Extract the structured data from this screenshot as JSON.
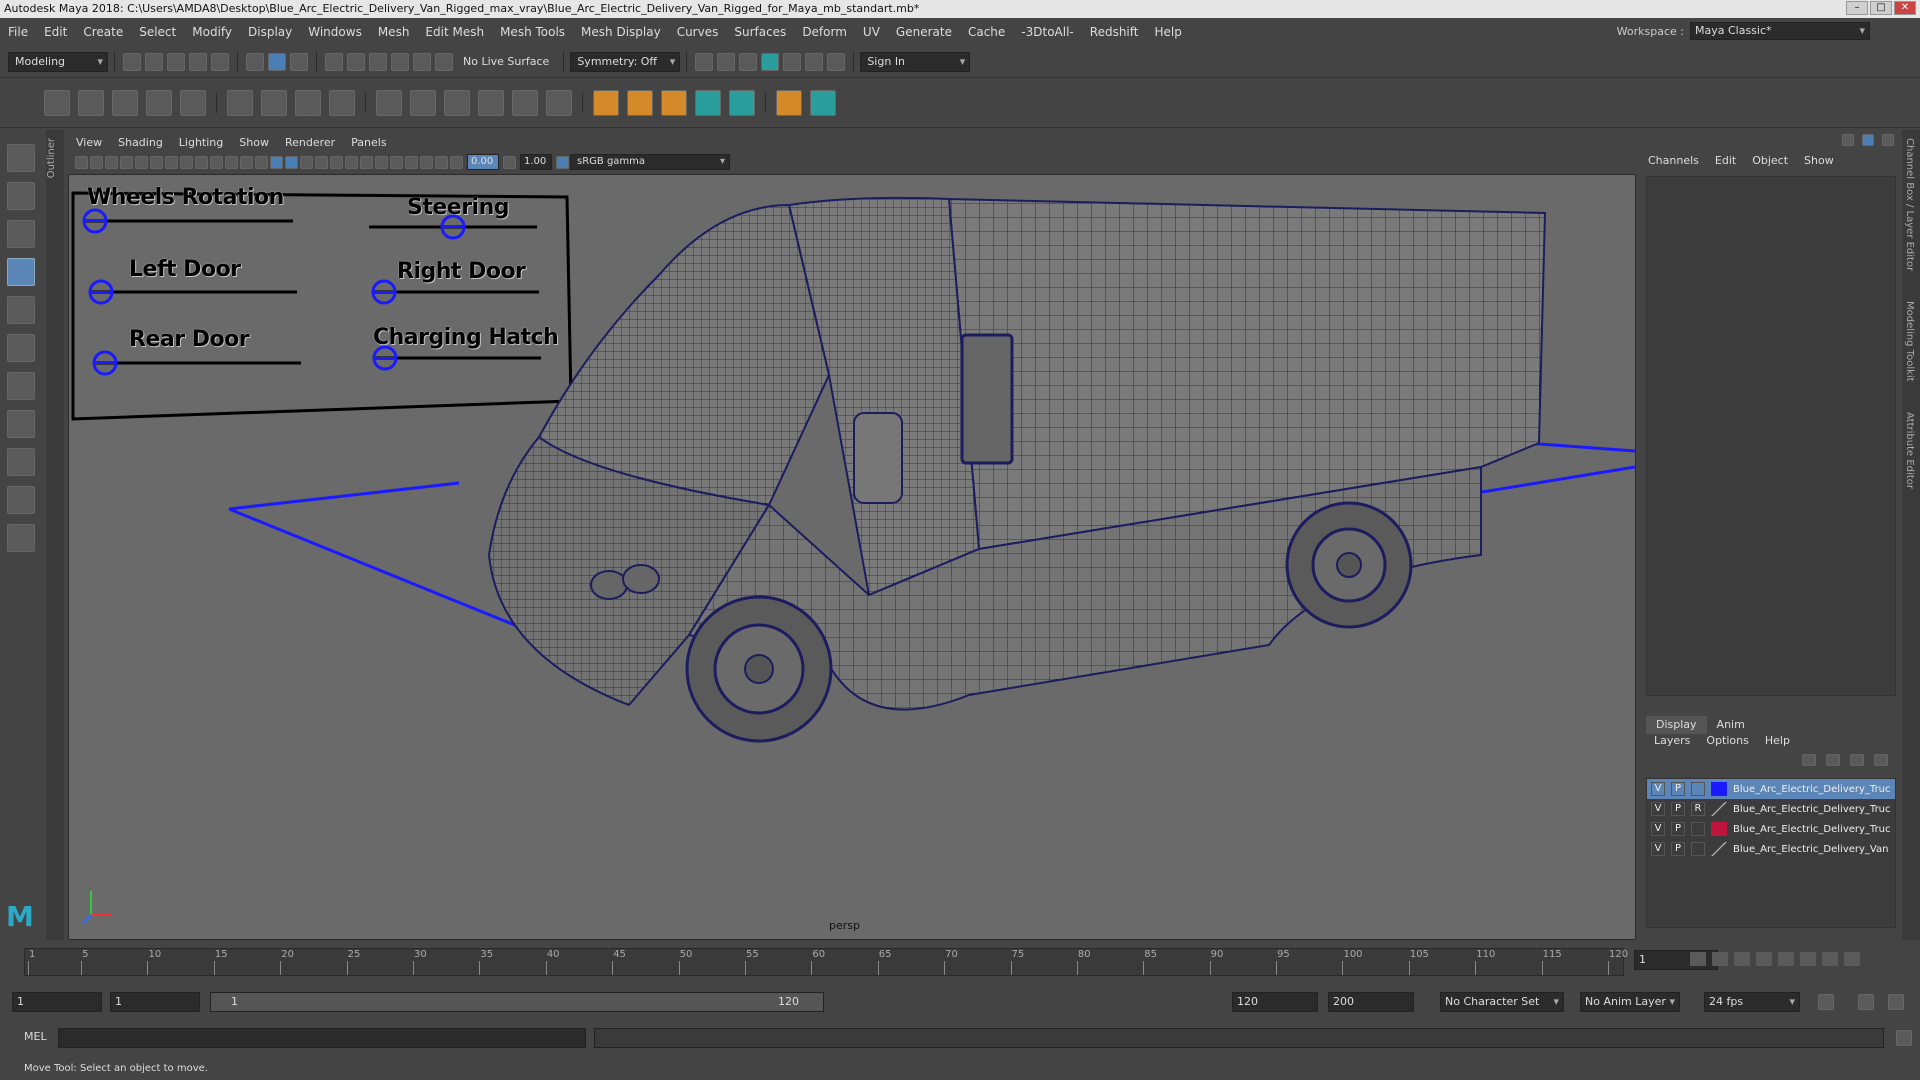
{
  "title_bar": {
    "text": "Autodesk Maya 2018: C:\\Users\\AMDA8\\Desktop\\Blue_Arc_Electric_Delivery_Van_Rigged_max_vray\\Blue_Arc_Electric_Delivery_Van_Rigged_for_Maya_mb_standart.mb*"
  },
  "menu": {
    "items": [
      "File",
      "Edit",
      "Create",
      "Select",
      "Modify",
      "Display",
      "Windows",
      "Mesh",
      "Edit Mesh",
      "Mesh Tools",
      "Mesh Display",
      "Curves",
      "Surfaces",
      "Deform",
      "UV",
      "Generate",
      "Cache",
      "-3DtoAll-",
      "Redshift",
      "Help"
    ],
    "workspace_label": "Workspace :",
    "workspace_value": "Maya Classic*"
  },
  "status_line": {
    "mode": "Modeling",
    "live_surface": "No Live Surface",
    "symmetry": "Symmetry: Off",
    "sign_in": "Sign In"
  },
  "viewport": {
    "menu": [
      "View",
      "Shading",
      "Lighting",
      "Show",
      "Renderer",
      "Panels"
    ],
    "exposure": "0.00",
    "gamma": "1.00",
    "color_space": "sRGB gamma",
    "camera_label": "persp",
    "controls": [
      {
        "label": "Wheels Rotation",
        "value": 0.0
      },
      {
        "label": "Steering",
        "value": 0.5
      },
      {
        "label": "Left Door",
        "value": 0.0
      },
      {
        "label": "Right Door",
        "value": 0.0
      },
      {
        "label": "Rear Door",
        "value": 0.0
      },
      {
        "label": "Charging Hatch",
        "value": 0.0
      }
    ]
  },
  "left_panel": {
    "outliner_tab": "Outliner"
  },
  "channel_box": {
    "menu": [
      "Channels",
      "Edit",
      "Object",
      "Show"
    ]
  },
  "layer_editor": {
    "tabs": [
      "Display",
      "Anim"
    ],
    "menu": [
      "Layers",
      "Options",
      "Help"
    ],
    "layers": [
      {
        "v": "V",
        "p": "P",
        "r": "",
        "color": "#1a1aff",
        "name": "Blue_Arc_Electric_Delivery_Truc",
        "selected": true
      },
      {
        "v": "V",
        "p": "P",
        "r": "R",
        "color": "none",
        "name": "Blue_Arc_Electric_Delivery_Truc",
        "selected": false
      },
      {
        "v": "V",
        "p": "P",
        "r": "",
        "color": "#c0143c",
        "name": "Blue_Arc_Electric_Delivery_Truc",
        "selected": false
      },
      {
        "v": "V",
        "p": "P",
        "r": "",
        "color": "none",
        "name": "Blue_Arc_Electric_Delivery_Van",
        "selected": false
      }
    ]
  },
  "side_tabs": [
    "Channel Box / Layer Editor",
    "Modeling Toolkit",
    "Attribute Editor"
  ],
  "time_slider": {
    "ticks": [
      "1",
      "5",
      "10",
      "15",
      "20",
      "25",
      "30",
      "35",
      "40",
      "45",
      "50",
      "55",
      "60",
      "65",
      "70",
      "75",
      "80",
      "85",
      "90",
      "95",
      "100",
      "105",
      "110",
      "115",
      "120"
    ],
    "current_frame": "1"
  },
  "range_slider": {
    "start": "1",
    "playback_start": "1",
    "range_left": "1",
    "range_right": "120",
    "playback_end": "120",
    "end": "200",
    "character_set": "No Character Set",
    "anim_layer": "No Anim Layer",
    "fps": "24 fps"
  },
  "command_line": {
    "label": "MEL"
  },
  "help_line": {
    "text": "Move Tool: Select an object to move."
  }
}
